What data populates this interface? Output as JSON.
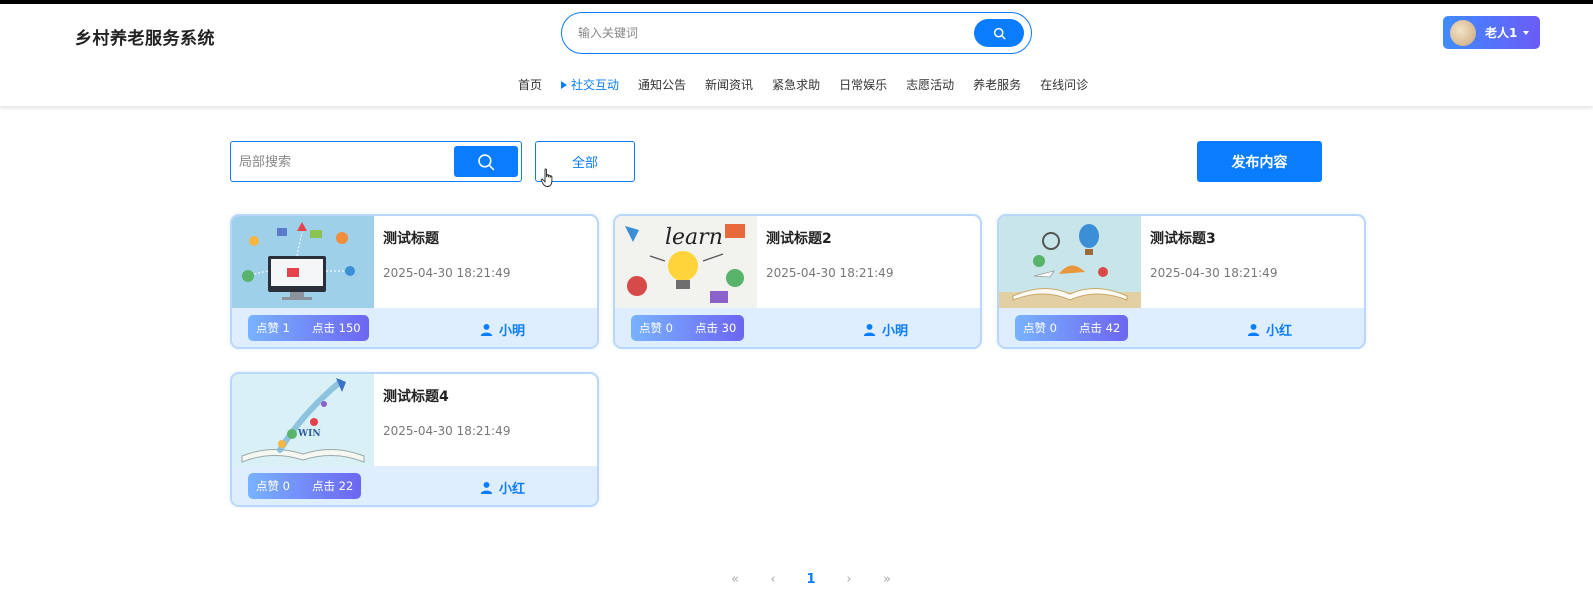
{
  "header": {
    "site_title": "乡村养老服务系统",
    "search_placeholder": "输入关键词",
    "user_name": "老人1",
    "accent": "#0a7cff"
  },
  "nav": [
    {
      "label": "首页",
      "active": false
    },
    {
      "label": "社交互动",
      "active": true
    },
    {
      "label": "通知公告",
      "active": false
    },
    {
      "label": "新闻资讯",
      "active": false
    },
    {
      "label": "紧急求助",
      "active": false
    },
    {
      "label": "日常娱乐",
      "active": false
    },
    {
      "label": "志愿活动",
      "active": false
    },
    {
      "label": "养老服务",
      "active": false
    },
    {
      "label": "在线问诊",
      "active": false
    }
  ],
  "toolbar": {
    "local_search_placeholder": "局部搜索",
    "all_label": "全部",
    "publish_label": "发布内容"
  },
  "posts": [
    {
      "title": "测试标题",
      "date": "2025-04-30 18:21:49",
      "likes": "点赞 1",
      "clicks": "点击 150",
      "author": "小明",
      "thumb": "computer-network-illustration"
    },
    {
      "title": "测试标题2",
      "date": "2025-04-30 18:21:49",
      "likes": "点赞 0",
      "clicks": "点击 30",
      "author": "小明",
      "thumb": "learn-lightbulb-illustration"
    },
    {
      "title": "测试标题3",
      "date": "2025-04-30 18:21:49",
      "likes": "点赞 0",
      "clicks": "点击 42",
      "author": "小红",
      "thumb": "open-book-travel-illustration"
    },
    {
      "title": "测试标题4",
      "date": "2025-04-30 18:21:49",
      "likes": "点赞 0",
      "clicks": "点击 22",
      "author": "小红",
      "thumb": "book-rocket-win-illustration"
    }
  ],
  "pagination": {
    "first": "«",
    "prev": "‹",
    "current": "1",
    "next": "›",
    "last": "»"
  }
}
